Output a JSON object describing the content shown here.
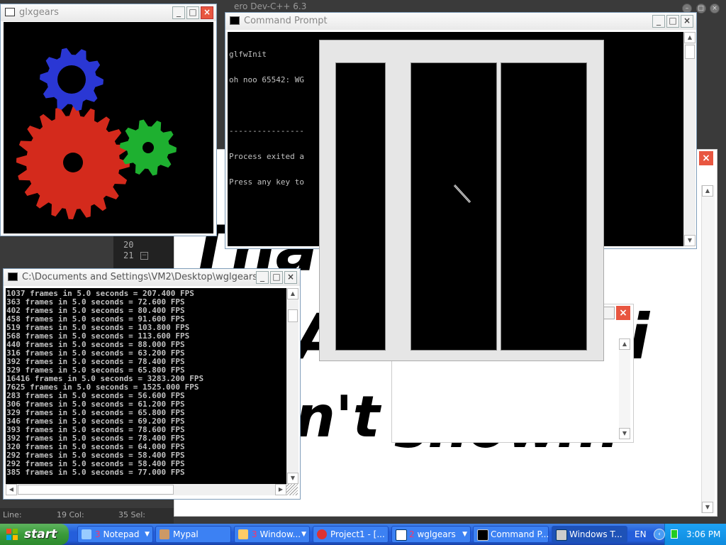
{
  "desktop": {
    "bg_title_fragment": "ero Dev-C++ 6.3",
    "big_text": [
      "Than",
      "A",
      "i",
      "n't",
      "show..."
    ],
    "line_numbers": [
      "20",
      "21"
    ],
    "status": {
      "line": "Line:",
      "col": "19 Col:",
      "sel": "35 Sel:"
    }
  },
  "glxgears": {
    "title": "glxgears",
    "gear_colors": {
      "red": "#d42a1c",
      "green": "#1eb030",
      "blue": "#2a37d4"
    }
  },
  "command_prompt": {
    "title": "Command Prompt",
    "lines": [
      "glfwInit",
      "oh noo 65542: WG",
      "",
      "----------------",
      "Process exited a",
      "Press any key to"
    ]
  },
  "wglgears": {
    "title": "C:\\Documents and Settings\\VM2\\Desktop\\wglgears....",
    "lines": [
      "1037 frames in 5.0 seconds = 207.400 FPS",
      "363 frames in 5.0 seconds = 72.600 FPS",
      "402 frames in 5.0 seconds = 80.400 FPS",
      "458 frames in 5.0 seconds = 91.600 FPS",
      "519 frames in 5.0 seconds = 103.800 FPS",
      "568 frames in 5.0 seconds = 113.600 FPS",
      "440 frames in 5.0 seconds = 88.000 FPS",
      "316 frames in 5.0 seconds = 63.200 FPS",
      "392 frames in 5.0 seconds = 78.400 FPS",
      "329 frames in 5.0 seconds = 65.800 FPS",
      "16416 frames in 5.0 seconds = 3283.200 FPS",
      "7625 frames in 5.0 seconds = 1525.000 FPS",
      "283 frames in 5.0 seconds = 56.600 FPS",
      "306 frames in 5.0 seconds = 61.200 FPS",
      "329 frames in 5.0 seconds = 65.800 FPS",
      "346 frames in 5.0 seconds = 69.200 FPS",
      "393 frames in 5.0 seconds = 78.600 FPS",
      "392 frames in 5.0 seconds = 78.400 FPS",
      "320 frames in 5.0 seconds = 64.000 FPS",
      "292 frames in 5.0 seconds = 58.400 FPS",
      "292 frames in 5.0 seconds = 58.400 FPS",
      "385 frames in 5.0 seconds = 77.000 FPS"
    ]
  },
  "taskbar": {
    "start_label": "start",
    "tasks": [
      {
        "count": "3",
        "label": "Notepad",
        "icon": "notepad-icon",
        "dropdown": true
      },
      {
        "count": "",
        "label": "Mypal",
        "icon": "mypal-icon",
        "dropdown": false
      },
      {
        "count": "3",
        "label": "Window...",
        "icon": "folder-icon",
        "dropdown": true
      },
      {
        "count": "",
        "label": "Project1 - [...",
        "icon": "devcpp-icon",
        "dropdown": false
      },
      {
        "count": "2",
        "label": "wglgears",
        "icon": "window-icon",
        "dropdown": true
      },
      {
        "count": "",
        "label": "Command P...",
        "icon": "cmd-icon",
        "dropdown": false
      },
      {
        "count": "",
        "label": "Windows T...",
        "icon": "taskmgr-icon",
        "dropdown": false,
        "active": true
      }
    ],
    "language": "EN",
    "clock": "3:06 PM"
  }
}
